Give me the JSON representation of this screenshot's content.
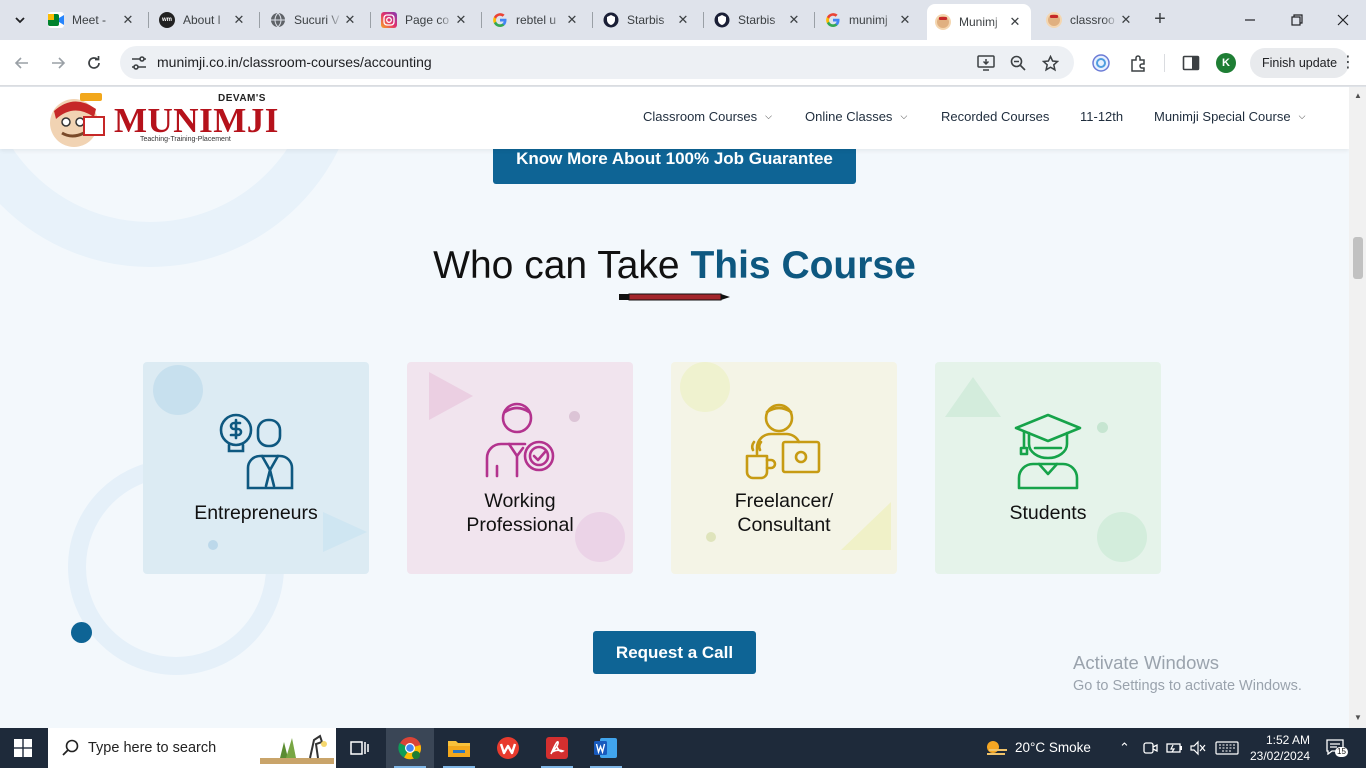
{
  "browser": {
    "tabs": [
      {
        "title": "Meet -",
        "favicon": "google-meet-icon",
        "active": false
      },
      {
        "title": "About l",
        "favicon": "site-icon",
        "active": false
      },
      {
        "title": "Sucuri V",
        "favicon": "globe-icon",
        "active": false
      },
      {
        "title": "Page co",
        "favicon": "instagram-icon",
        "active": false
      },
      {
        "title": "rebtel u",
        "favicon": "google-icon",
        "active": false
      },
      {
        "title": "Starbis",
        "favicon": "shield-icon",
        "active": false
      },
      {
        "title": "Starbis",
        "favicon": "shield-icon",
        "active": false
      },
      {
        "title": "munimj",
        "favicon": "google-icon",
        "active": false
      },
      {
        "title": "Munimj",
        "favicon": "munimji-icon",
        "active": true
      },
      {
        "title": "classroo",
        "favicon": "munimji-icon",
        "active": false
      }
    ],
    "url": "munimji.co.in/classroom-courses/accounting",
    "profile_initial": "K",
    "finish_update_label": "Finish update"
  },
  "site": {
    "logo": {
      "top": "DEVAM'S",
      "brand": "MUNIMJI",
      "tagline": "Teaching-Training-Placement"
    },
    "menu": [
      {
        "label": "Classroom Courses",
        "has_dropdown": true
      },
      {
        "label": "Online Classes",
        "has_dropdown": true
      },
      {
        "label": "Recorded Courses",
        "has_dropdown": false
      },
      {
        "label": "11-12th",
        "has_dropdown": false
      },
      {
        "label": "Munimji Special Course",
        "has_dropdown": true
      }
    ],
    "cta_top": "Know More About 100% Job Guarantee",
    "heading": {
      "plain": "Who can Take ",
      "accent": "This Course"
    },
    "cards": [
      {
        "label": "Entrepreneurs",
        "icon": "entrepreneur-icon",
        "bg": "#dcebf3",
        "color": "#0e5880"
      },
      {
        "label": "Working Professional",
        "line1": "Working",
        "line2": "Professional",
        "icon": "professional-icon",
        "bg": "#f1e4ee",
        "color": "#b3338e"
      },
      {
        "label": "Freelancer/ Consultant",
        "line1": "Freelancer/",
        "line2": "Consultant",
        "icon": "freelancer-icon",
        "bg": "#f4f4e6",
        "color": "#c79b13"
      },
      {
        "label": "Students",
        "icon": "graduate-icon",
        "bg": "#e5f3ea",
        "color": "#16a34a"
      }
    ],
    "cta_bottom": "Request a Call",
    "accent_color": "#0e6495"
  },
  "watermark": {
    "line1": "Activate Windows",
    "line2": "Go to Settings to activate Windows."
  },
  "taskbar": {
    "search_placeholder": "Type here to search",
    "weather": "20°C  Smoke",
    "time": "1:52 AM",
    "date": "23/02/2024",
    "notification_count": "15"
  }
}
